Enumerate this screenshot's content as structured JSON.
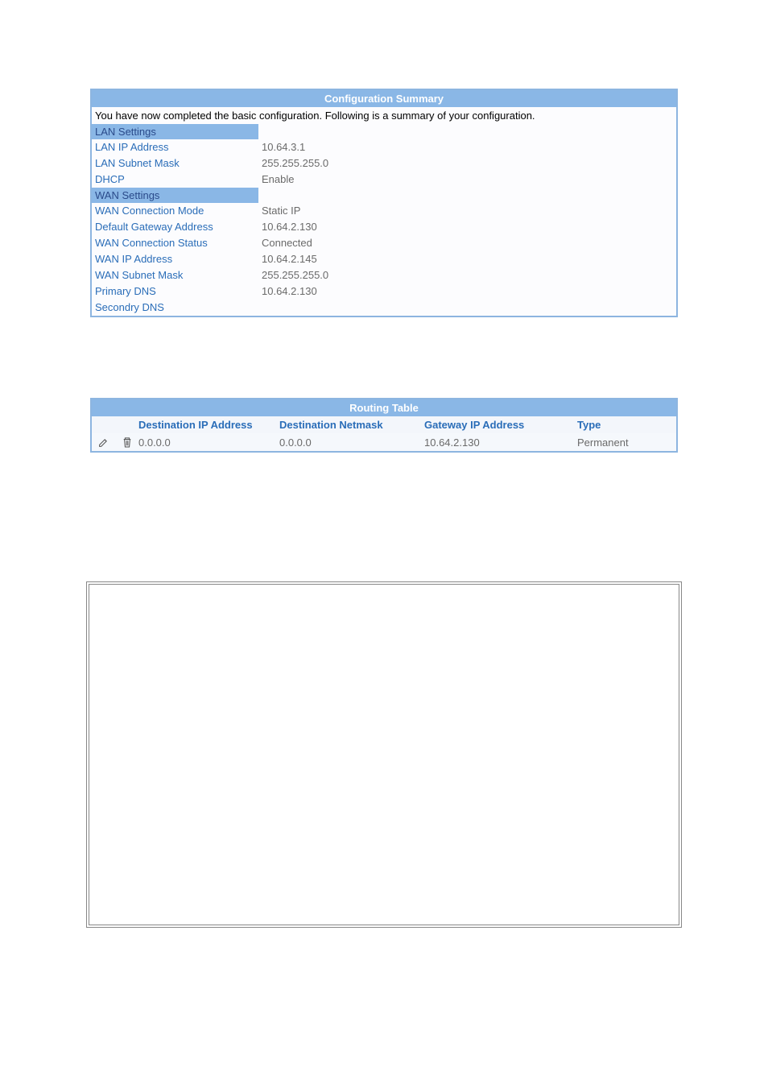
{
  "config_summary": {
    "title": "Configuration Summary",
    "intro": "You have now completed the basic configuration. Following is a summary of your configuration.",
    "lan_section": "LAN Settings",
    "wan_section": "WAN Settings",
    "rows": {
      "lan_ip": {
        "label": "LAN IP Address",
        "value": "10.64.3.1"
      },
      "lan_subnet": {
        "label": "LAN Subnet Mask",
        "value": "255.255.255.0"
      },
      "dhcp": {
        "label": "DHCP",
        "value": "Enable"
      },
      "wan_mode": {
        "label": "WAN Connection Mode",
        "value": "Static IP"
      },
      "default_gw": {
        "label": "Default Gateway Address",
        "value": "10.64.2.130"
      },
      "wan_status": {
        "label": "WAN Connection Status",
        "value": "Connected"
      },
      "wan_ip": {
        "label": "WAN IP Address",
        "value": "10.64.2.145"
      },
      "wan_subnet": {
        "label": "WAN Subnet Mask",
        "value": "255.255.255.0"
      },
      "primary_dns": {
        "label": "Primary DNS",
        "value": "10.64.2.130"
      },
      "secondary_dns": {
        "label": "Secondry DNS",
        "value": ""
      }
    }
  },
  "routing_table": {
    "title": "Routing Table",
    "headers": {
      "dest_ip": "Destination IP Address",
      "dest_nm": "Destination Netmask",
      "gw_ip": "Gateway IP Address",
      "type": "Type"
    },
    "rows": [
      {
        "dest_ip": "0.0.0.0",
        "dest_nm": "0.0.0.0",
        "gw_ip": "10.64.2.130",
        "type": "Permanent"
      }
    ]
  }
}
